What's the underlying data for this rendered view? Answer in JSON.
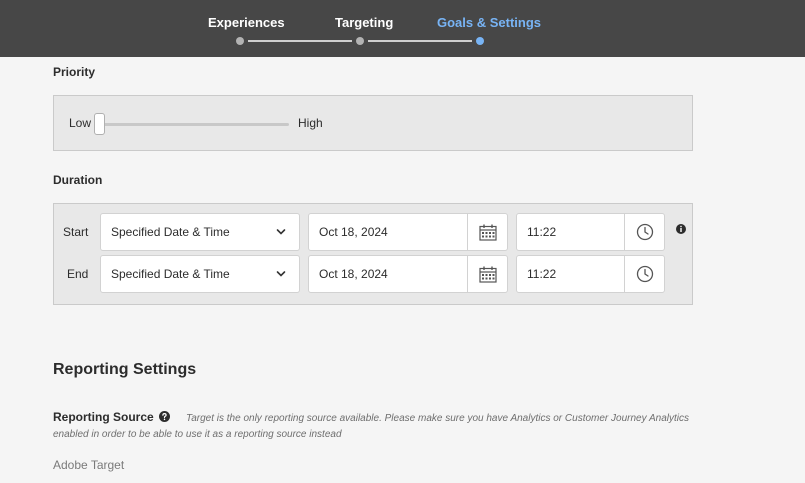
{
  "stepper": {
    "steps": [
      {
        "label": "Experiences",
        "state": "completed"
      },
      {
        "label": "Targeting",
        "state": "completed"
      },
      {
        "label": "Goals & Settings",
        "state": "active"
      }
    ],
    "colors": {
      "bar": "#474747",
      "active": "#78b4f5"
    }
  },
  "priority": {
    "label": "Priority",
    "low_label": "Low",
    "high_label": "High",
    "value_fraction": 0.0
  },
  "duration": {
    "label": "Duration",
    "rows": [
      {
        "label": "Start",
        "mode": "Specified Date & Time",
        "date": "Oct 18, 2024",
        "time": "11:22"
      },
      {
        "label": "End",
        "mode": "Specified Date & Time",
        "date": "Oct 18, 2024",
        "time": "11:22"
      }
    ],
    "icons": {
      "mode": "chevron-down-icon",
      "date": "calendar-icon",
      "time": "clock-icon",
      "info": "info-icon"
    }
  },
  "reporting": {
    "title": "Reporting Settings",
    "source_label": "Reporting Source",
    "note": "Target is the only reporting source available. Please make sure you have Analytics or Customer Journey Analytics enabled in order to be able to use it as a reporting source instead",
    "source_value": "Adobe Target",
    "help_icon": "help-icon"
  }
}
